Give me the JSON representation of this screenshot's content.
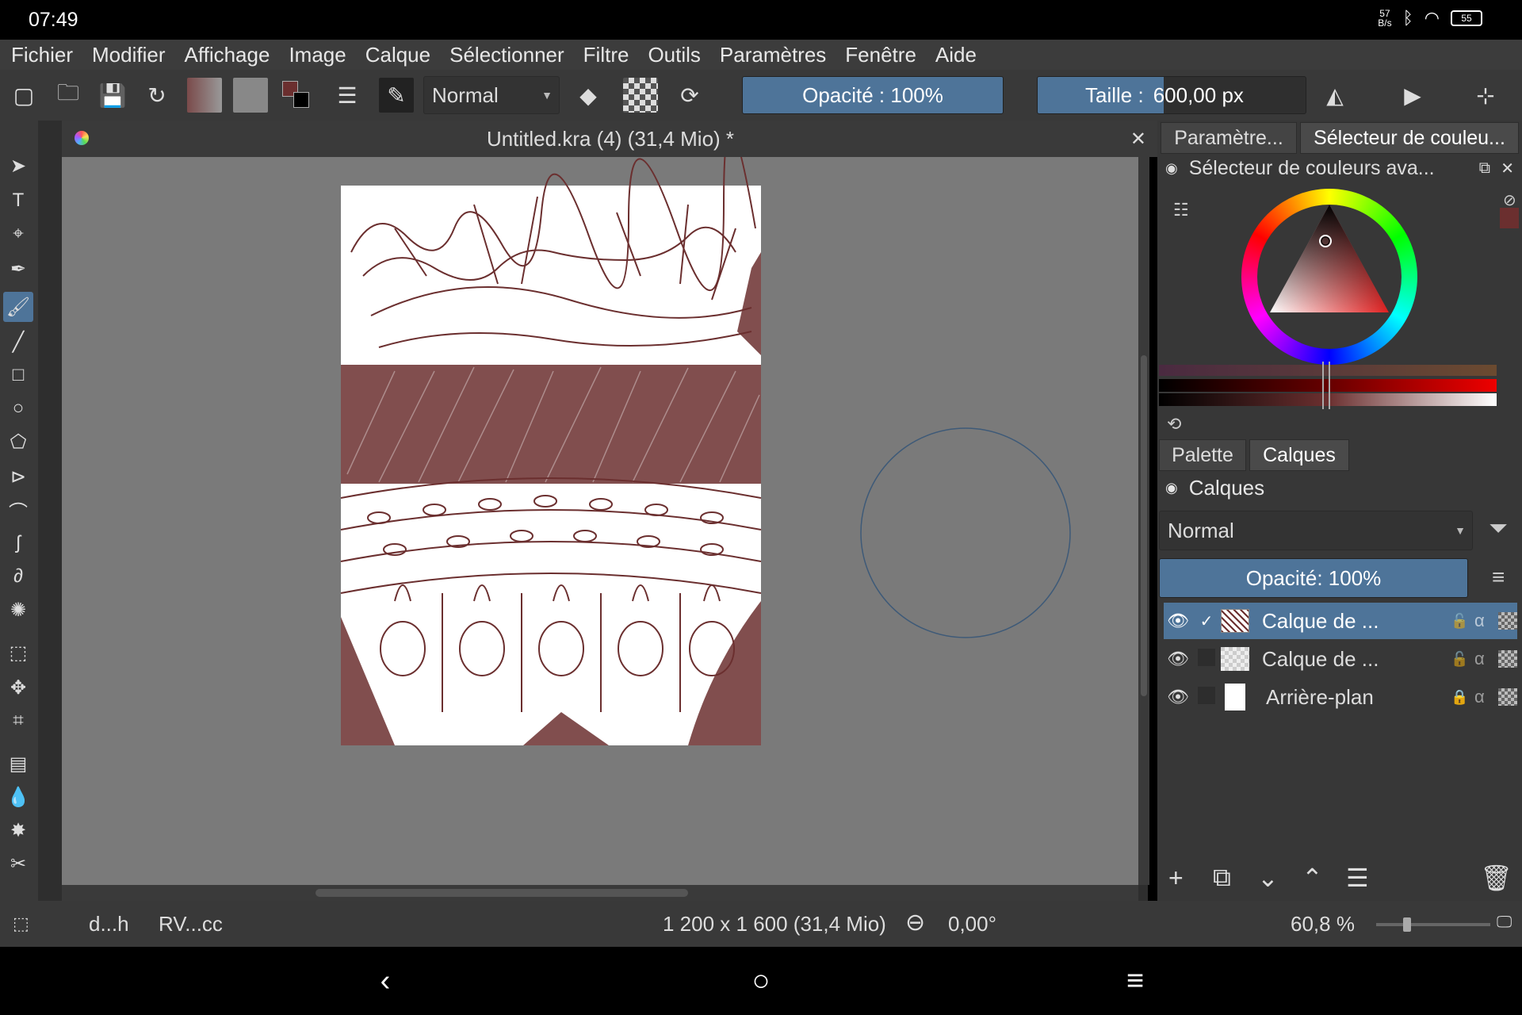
{
  "status_bar": {
    "time": "07:49",
    "net_speed_top": "57",
    "net_speed_bottom": "B/s",
    "battery": "55"
  },
  "menu": [
    "Fichier",
    "Modifier",
    "Affichage",
    "Image",
    "Calque",
    "Sélectionner",
    "Filtre",
    "Outils",
    "Paramètres",
    "Fenêtre",
    "Aide"
  ],
  "toolbar": {
    "blend_mode": "Normal",
    "opacity_label": "Opacité : 100%",
    "opacity_value": 1.0,
    "size_label": "Taille :",
    "size_value_text": "600,00 px",
    "size_fill_fraction": 0.47
  },
  "document": {
    "tab_title": "Untitled.kra (4) (31,4 Mio) *",
    "close_glyph": "✕"
  },
  "docker_tabs": {
    "top": [
      "Paramètre...",
      "Sélecteur de couleu..."
    ],
    "bottom": [
      "Palette",
      "Calques"
    ]
  },
  "color_selector": {
    "title": "Sélecteur de couleurs ava...",
    "current_color": "#6b2f2f"
  },
  "layers_panel": {
    "title": "Calques",
    "blend_mode": "Normal",
    "opacity_label": "Opacité:  100%",
    "layers": [
      {
        "name": "Calque de ...",
        "visible": true,
        "selected": true,
        "checked": true
      },
      {
        "name": "Calque de ...",
        "visible": true,
        "selected": false,
        "checked": false
      },
      {
        "name": "Arrière-plan",
        "visible": true,
        "selected": false,
        "checked": false,
        "locked": true
      }
    ]
  },
  "status": {
    "brush_name": "d...h",
    "color_profile": "RV...cc",
    "image_size": "1 200 x 1 600 (31,4 Mio)",
    "rotation": "0,00°",
    "zoom": "60,8 %"
  },
  "colors": {
    "accent": "#4e7499",
    "ink": "#6b2f2f"
  }
}
